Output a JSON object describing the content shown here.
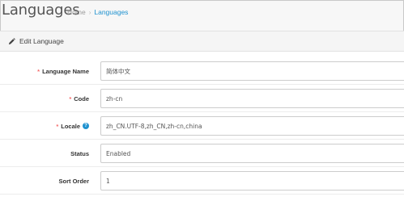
{
  "header": {
    "title": "Languages",
    "breadcrumb": {
      "home": "Home",
      "separator": "›",
      "current": "Languages"
    }
  },
  "panel": {
    "heading": "Edit Language",
    "heading_icon": "pencil-icon"
  },
  "form": {
    "fields": [
      {
        "label": "Language Name",
        "required": "*",
        "value": "简体中文"
      },
      {
        "label": "Code",
        "required": "*",
        "value": "zh-cn"
      },
      {
        "label": "Locale",
        "required": "*",
        "help": "?",
        "value": "zh_CN.UTF-8,zh_CN,zh-cn,china"
      },
      {
        "label": "Status",
        "value": "Enabled"
      },
      {
        "label": "Sort Order",
        "value": "1"
      }
    ]
  },
  "colors": {
    "accent": "#1e91cf",
    "required": "#f56b6b"
  }
}
